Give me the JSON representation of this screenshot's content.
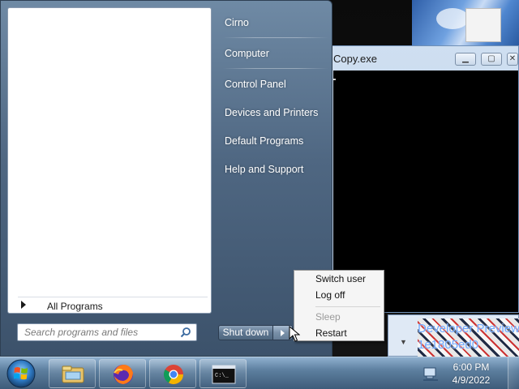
{
  "start_menu": {
    "right_items": [
      {
        "label": "Cirno"
      },
      {
        "label": "Computer"
      },
      {
        "label": "Control Panel"
      },
      {
        "label": "Devices and Printers"
      },
      {
        "label": "Default Programs"
      },
      {
        "label": "Help and Support"
      }
    ],
    "all_programs_label": "All Programs",
    "search_placeholder": "Search programs and files",
    "shutdown_label": "Shut down"
  },
  "power_menu": {
    "items": [
      {
        "label": "Switch user",
        "enabled": true
      },
      {
        "label": "Log off",
        "enabled": true
      },
      {
        "label": "Sleep",
        "enabled": false
      },
      {
        "label": "Restart",
        "enabled": true
      }
    ]
  },
  "background_windows": {
    "console_title": "Copy.exe",
    "art_text_line1": "Developer Preview",
    "art_text_line2": "1e1805ed0"
  },
  "taskbar": {
    "pinned": [
      {
        "icon": "windows-explorer-icon"
      },
      {
        "icon": "firefox-icon"
      },
      {
        "icon": "chrome-icon"
      },
      {
        "icon": "command-prompt-icon"
      }
    ],
    "clock": {
      "time": "6:00 PM",
      "date": "4/9/2022"
    }
  },
  "colors": {
    "start_menu_right": "#4f6782",
    "taskbar": "#5d7f9f",
    "console_bg": "#000000"
  }
}
